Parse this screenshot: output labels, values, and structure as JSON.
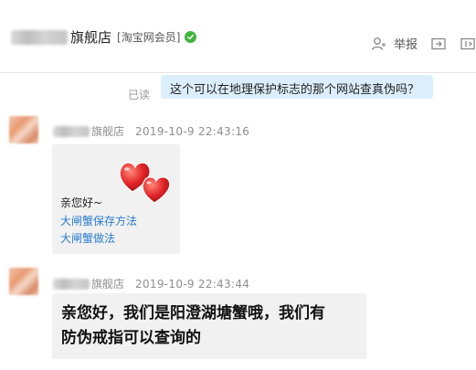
{
  "header": {
    "shop_name": "旗舰店",
    "member_tag": "[淘宝网会员]",
    "report_label": "举报",
    "icons": [
      "user-plus-icon",
      "share-icon",
      "collapse-icon"
    ]
  },
  "messages": {
    "outgoing": {
      "status": "已读",
      "text": "这个可以在地理保护标志的那个网站查真伪吗？"
    },
    "incoming": [
      {
        "sender": "旗舰店",
        "time": "2019-10-9 22:43:16",
        "sticker": "hearts-sticker",
        "greeting": "亲您好~",
        "links": [
          "大闸蟹保存方法",
          "大闸蟹做法"
        ]
      },
      {
        "sender": "旗舰店",
        "time": "2019-10-9 22:43:44",
        "lines": [
          "亲您好，我们是阳澄湖塘蟹哦，我们有",
          "防伪戒指可以查询的"
        ]
      }
    ]
  },
  "colors": {
    "accent_link": "#2a7ccc",
    "outgoing_bubble": "#dceefc",
    "incoming_bubble": "#f1f1f1",
    "verified": "#3fb53f"
  }
}
